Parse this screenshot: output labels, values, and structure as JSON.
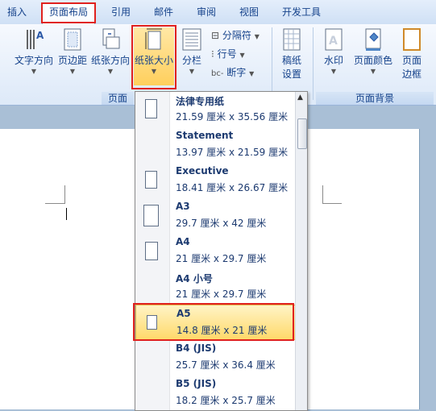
{
  "tabs": [
    {
      "label": "插入",
      "active": false
    },
    {
      "label": "页面布局",
      "active": true
    },
    {
      "label": "引用",
      "active": false
    },
    {
      "label": "邮件",
      "active": false
    },
    {
      "label": "审阅",
      "active": false
    },
    {
      "label": "视图",
      "active": false
    },
    {
      "label": "开发工具",
      "active": false
    }
  ],
  "ribbon": {
    "page_setup": {
      "text_direction": "文字方向",
      "margins": "页边距",
      "orientation": "纸张方向",
      "size": "纸张大小",
      "columns": "分栏",
      "breaks": "分隔符",
      "line_numbers": "行号",
      "hyphenation": "断字",
      "group_label": "页面"
    },
    "manuscript": {
      "label_line1": "稿纸",
      "label_line2": "设置"
    },
    "page_background": {
      "watermark": "水印",
      "page_color": "页面颜色",
      "borders_line1": "页面",
      "borders_line2": "边框",
      "group_label": "页面背景"
    }
  },
  "paper_sizes": [
    {
      "name": "法律专用纸",
      "dims": "21.59 厘米 x 35.56 厘米"
    },
    {
      "name": "Statement",
      "dims": "13.97 厘米 x 21.59 厘米"
    },
    {
      "name": "Executive",
      "dims": "18.41 厘米 x 26.67 厘米"
    },
    {
      "name": "A3",
      "dims": "29.7 厘米 x 42 厘米"
    },
    {
      "name": "A4",
      "dims": "21 厘米 x 29.7 厘米"
    },
    {
      "name": "A4 小号",
      "dims": "21 厘米 x 29.7 厘米"
    },
    {
      "name": "A5",
      "dims": "14.8 厘米 x 21 厘米",
      "highlighted": true
    },
    {
      "name": "B4 (JIS)",
      "dims": "25.7 厘米 x 36.4 厘米"
    },
    {
      "name": "B5 (JIS)",
      "dims": "18.2 厘米 x 25.7 厘米"
    }
  ],
  "colors": {
    "highlight": "#ffd96a",
    "annotation": "#e0211e",
    "ribbon_text": "#15428b"
  }
}
